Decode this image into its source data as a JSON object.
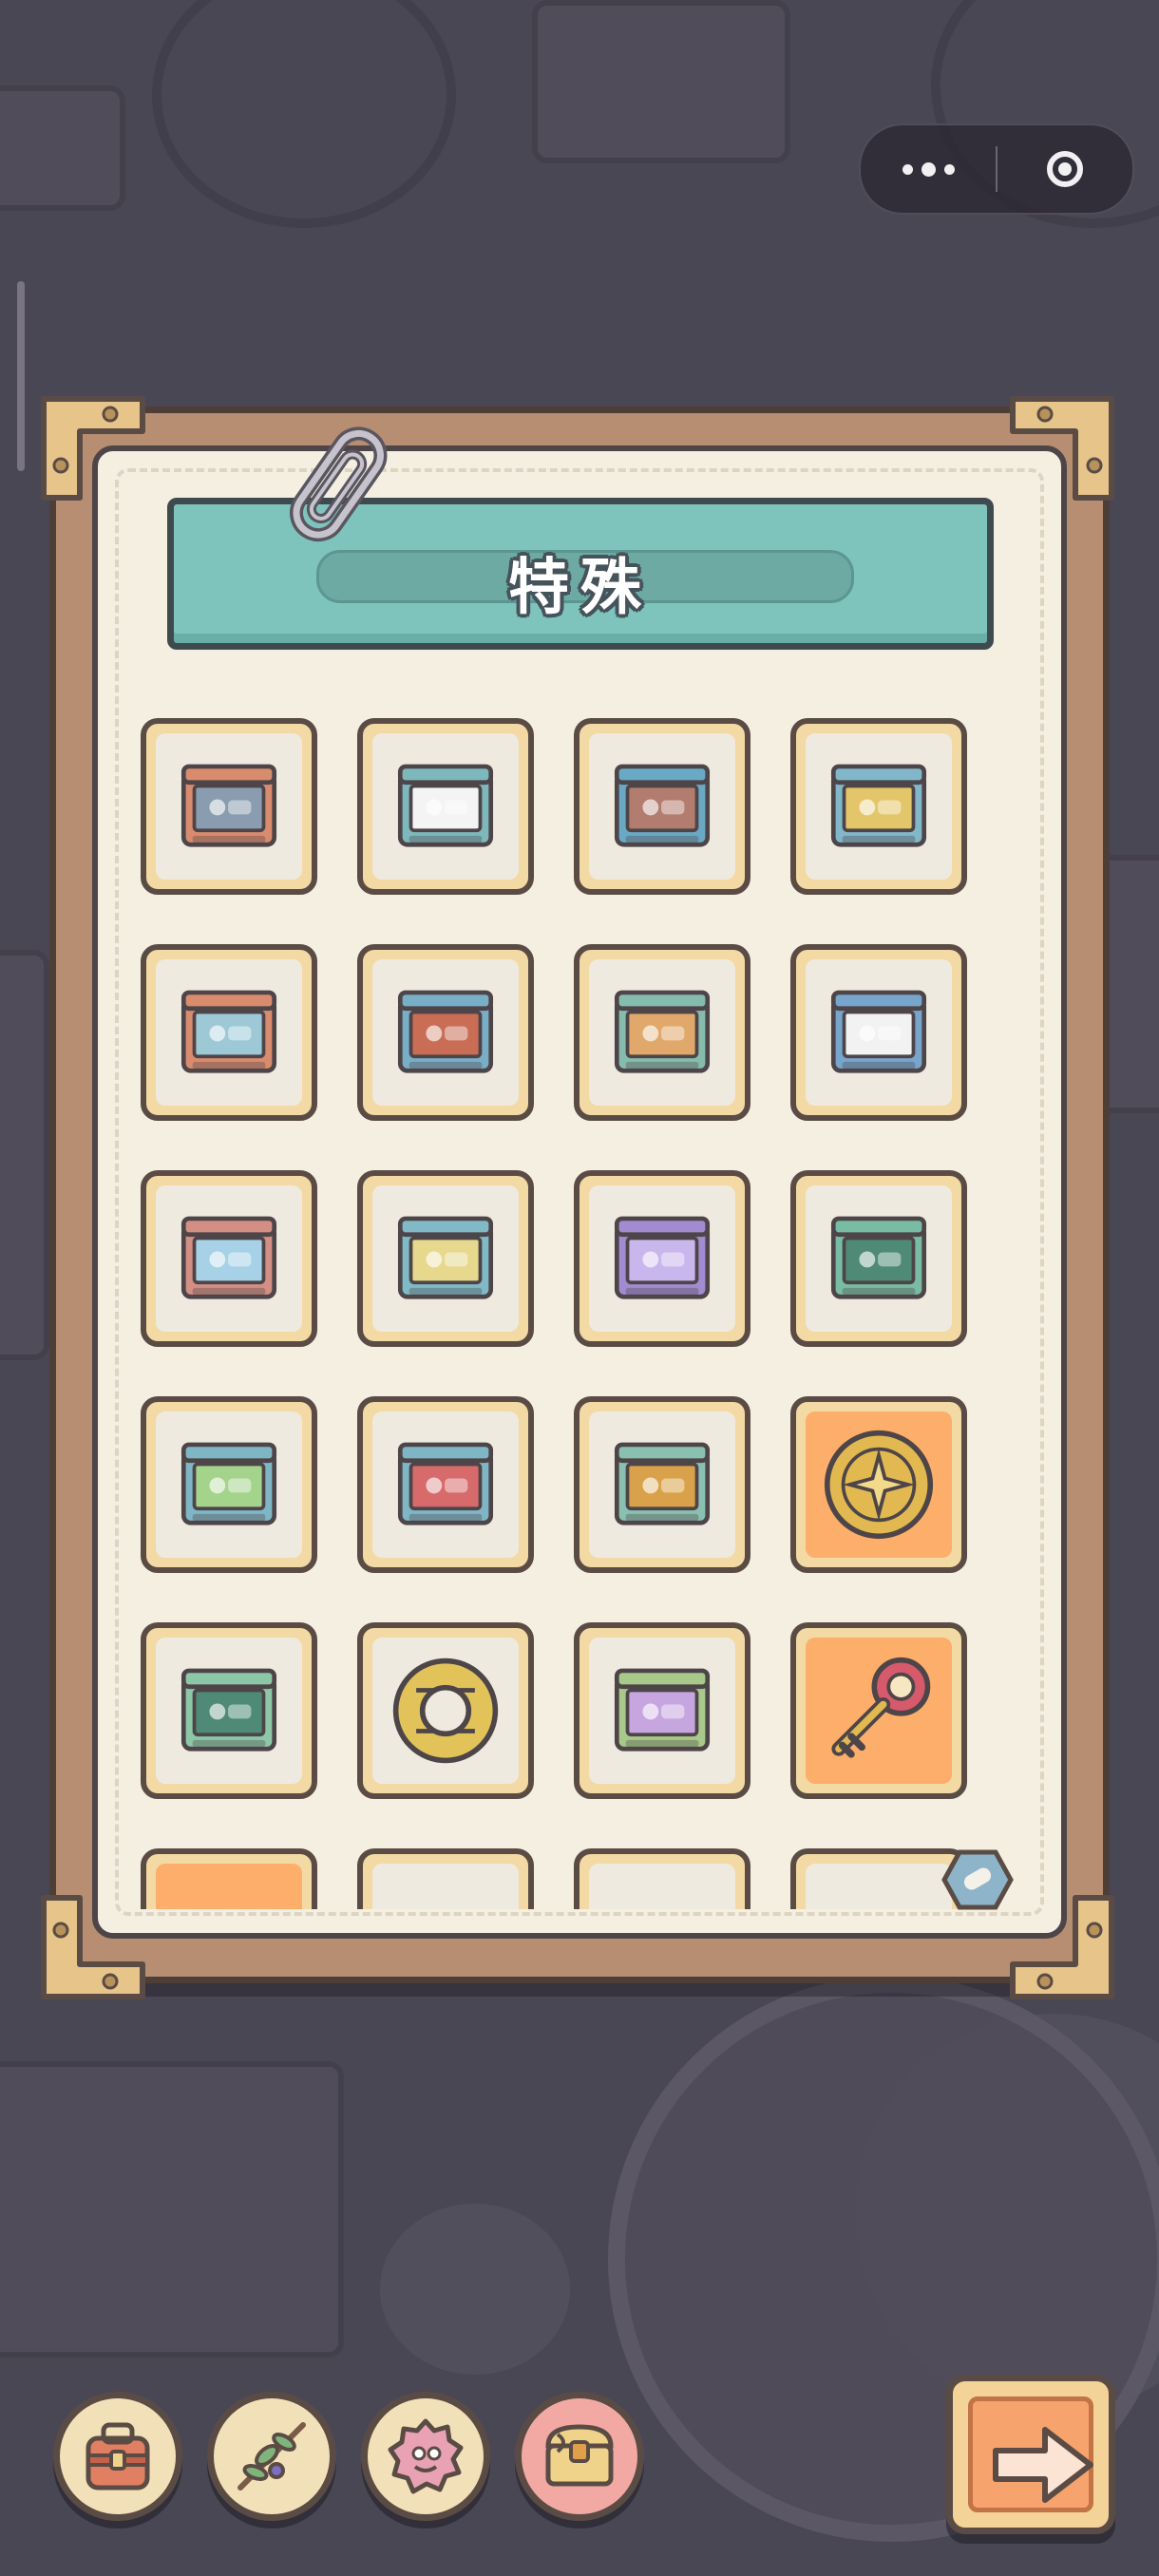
{
  "header": {
    "title": "特殊"
  },
  "capsule": {
    "more_icon": "more-dots-icon",
    "close_icon": "target-close-icon"
  },
  "grid": {
    "items": [
      {
        "icon": "cartridge-snail",
        "color": "#d98b6e",
        "label_color": "#8a9db0",
        "highlighted": false
      },
      {
        "icon": "cartridge-cards",
        "color": "#7db8bd",
        "label_color": "#f4f4f4",
        "highlighted": false
      },
      {
        "icon": "cartridge-maze",
        "color": "#6aa9c4",
        "label_color": "#b27c6f",
        "highlighted": false
      },
      {
        "icon": "cartridge-ship",
        "color": "#82b6c9",
        "label_color": "#e4c66a",
        "highlighted": false
      },
      {
        "icon": "cartridge-eyes",
        "color": "#d98b6e",
        "label_color": "#9dc8d6",
        "highlighted": false
      },
      {
        "icon": "cartridge-rabbit",
        "color": "#79aec7",
        "label_color": "#c96d54",
        "highlighted": false
      },
      {
        "icon": "cartridge-rocket",
        "color": "#86bcae",
        "label_color": "#e0a86a",
        "highlighted": false
      },
      {
        "icon": "cartridge-ant",
        "color": "#77a5cc",
        "label_color": "#f2f2f2",
        "highlighted": false
      },
      {
        "icon": "cartridge-mountain",
        "color": "#d38f83",
        "label_color": "#a6d1e6",
        "highlighted": false
      },
      {
        "icon": "cartridge-blocks",
        "color": "#7fbac6",
        "label_color": "#e6d88c",
        "highlighted": false
      },
      {
        "icon": "cartridge-purple",
        "color": "#a28bd0",
        "label_color": "#c9b6ec",
        "highlighted": false
      },
      {
        "icon": "cartridge-fish",
        "color": "#79bca4",
        "label_color": "#4f8a77",
        "highlighted": false
      },
      {
        "icon": "cartridge-squares",
        "color": "#7fb6c5",
        "label_color": "#a4d38c",
        "highlighted": false
      },
      {
        "icon": "cartridge-heart",
        "color": "#7fb6c5",
        "label_color": "#d76a6a",
        "highlighted": false
      },
      {
        "icon": "cartridge-fruit",
        "color": "#8ac0b0",
        "label_color": "#d9a24a",
        "highlighted": false
      },
      {
        "icon": "gold-coin",
        "color": "#e2b950",
        "label_color": "#c79a2e",
        "highlighted": true
      },
      {
        "icon": "cartridge-fish-green",
        "color": "#8cc7a8",
        "label_color": "#4f8a77",
        "highlighted": false
      },
      {
        "icon": "ancient-ring",
        "color": "#e2c35a",
        "label_color": "#8a7a3a",
        "highlighted": false
      },
      {
        "icon": "cartridge-bricks",
        "color": "#a8c98a",
        "label_color": "#c7a6e0",
        "highlighted": false
      },
      {
        "icon": "ornate-key",
        "color": "#e2b950",
        "label_color": "#d65a6b",
        "highlighted": true
      },
      {
        "icon": "partial-item-orange",
        "color": "#e2c35a",
        "label_color": "#c79a2e",
        "highlighted": true
      },
      {
        "icon": "partial-item-purple",
        "color": "#b79ad8",
        "label_color": "#8a6fc0",
        "highlighted": false
      },
      {
        "icon": "partial-item-red",
        "color": "#e08a7a",
        "label_color": "#c65a4a",
        "highlighted": false
      },
      {
        "icon": "partial-item-tan",
        "color": "#e2c98a",
        "label_color": "#b09450",
        "highlighted": false
      }
    ]
  },
  "toolbar": {
    "buttons": [
      {
        "icon": "backpack-icon",
        "active": false
      },
      {
        "icon": "leaf-branch-icon",
        "active": false
      },
      {
        "icon": "gear-badge-icon",
        "active": false
      },
      {
        "icon": "treasure-chest-icon",
        "active": true
      }
    ],
    "next_icon": "arrow-right-icon"
  },
  "colors": {
    "board_wood": "#b88e72",
    "board_paper": "#f5efe2",
    "banner_teal": "#7fc3bd",
    "slot_gold": "#f3d9a3",
    "highlight_orange": "#fdae6a",
    "outline": "#5a4c45"
  }
}
